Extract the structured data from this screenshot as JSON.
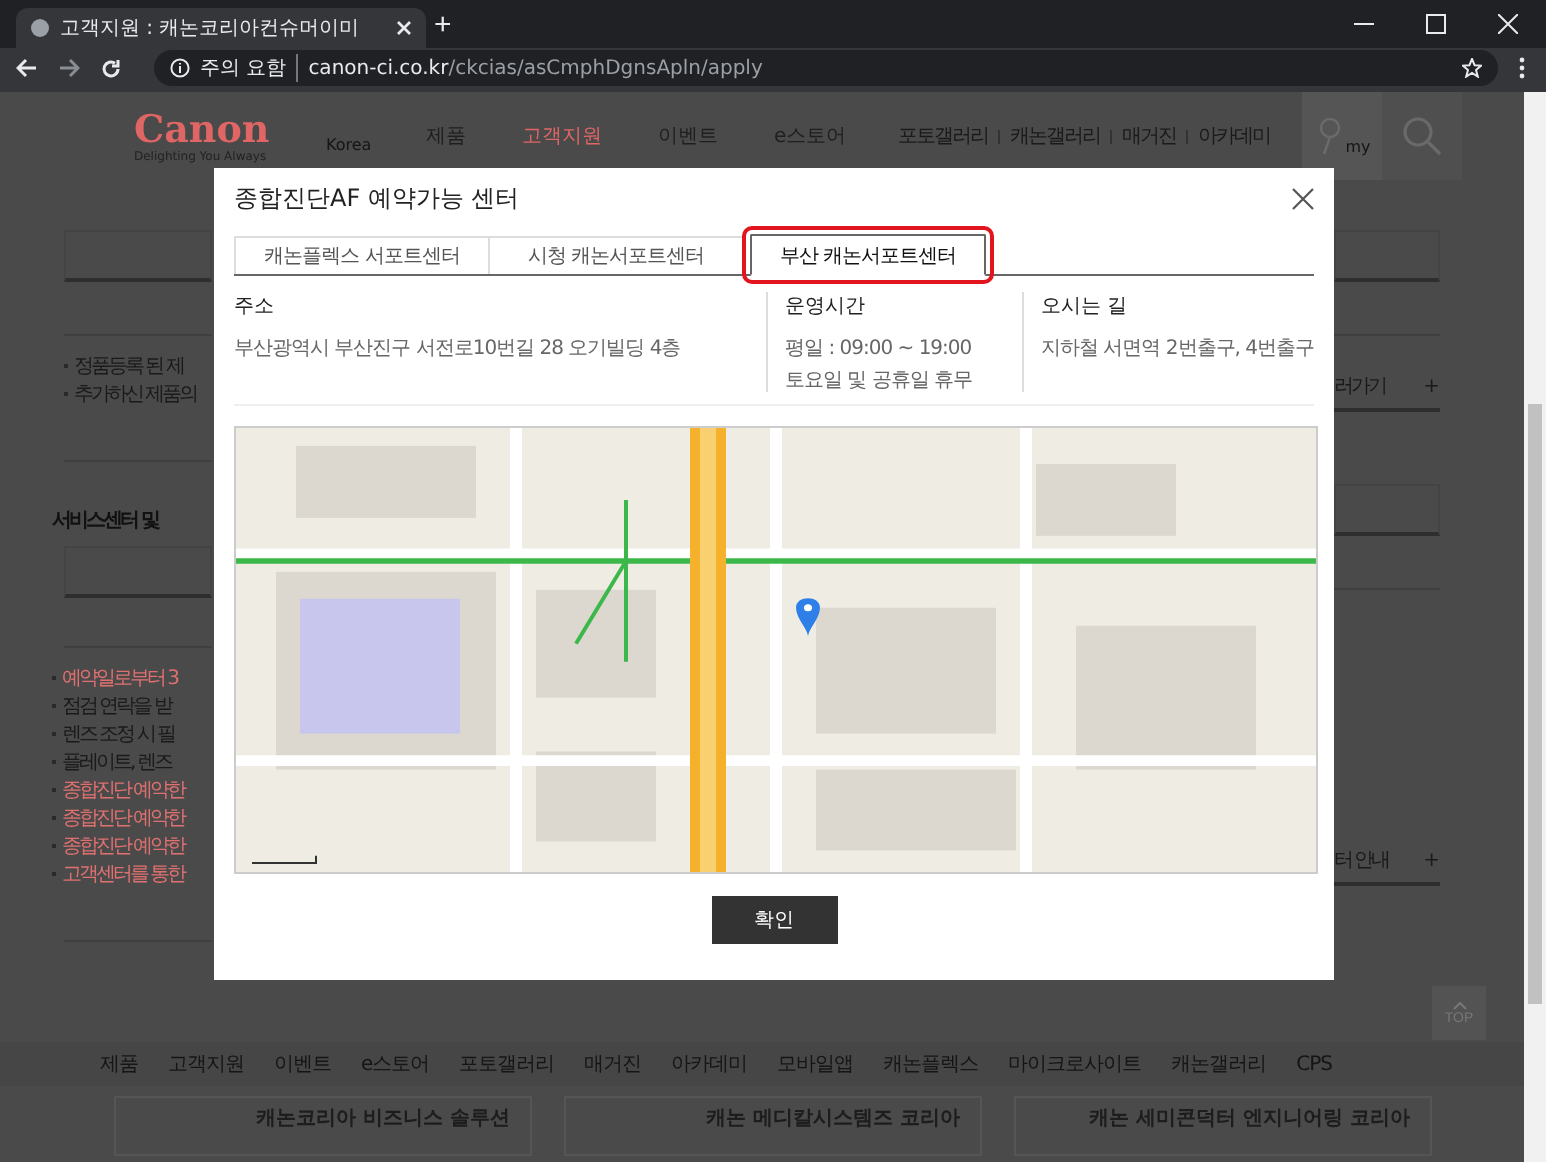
{
  "browser": {
    "tab_title": "고객지원 : 캐논코리아컨슈머이미",
    "new_tab": "+",
    "security": "주의 요함",
    "url_host": "canon-ci.co.kr",
    "url_path": "/ckcias/asCmphDgnsApln/apply"
  },
  "header": {
    "logo": "Canon",
    "tagline": "Delighting You Always",
    "region": "Korea",
    "nav": [
      {
        "label": "제품",
        "selected": false
      },
      {
        "label": "고객지원",
        "selected": true
      },
      {
        "label": "이벤트",
        "selected": false
      },
      {
        "label": "e스토어",
        "selected": false
      }
    ],
    "links": [
      "포토갤러리",
      "캐논갤러리",
      "매거진",
      "아카데미"
    ],
    "my_label": "my"
  },
  "background": {
    "notes": [
      "정품등록 된 제",
      "추가하신 제품의"
    ],
    "heading": "서비스센터 및",
    "bullets": [
      {
        "text": "예약일로부터 3",
        "highlighted": true
      },
      {
        "text": "점검 연락을 받",
        "highlighted": false
      },
      {
        "text": "렌즈 조정 시 필",
        "highlighted": false
      },
      {
        "text": "플레이트, 렌즈",
        "highlighted": false
      },
      {
        "text": "종합진단 예약한",
        "highlighted": true
      },
      {
        "text": "종합진단 예약한",
        "highlighted": true
      },
      {
        "text": "종합진단 예약한",
        "highlighted": true
      },
      {
        "text": "고객센터를 통한",
        "highlighted": true
      }
    ],
    "right_links": [
      {
        "text": "러가기",
        "toggle": "+"
      },
      {
        "text": "터 안내",
        "toggle": "+"
      }
    ]
  },
  "modal": {
    "title": "종합진단AF 예약가능 센터",
    "tabs": [
      {
        "label": "캐논플렉스 서포트센터",
        "selected": false
      },
      {
        "label": "시청 캐논서포트센터",
        "selected": false
      },
      {
        "label": "부산 캐논서포트센터",
        "selected": true
      }
    ],
    "info": [
      {
        "label": "주소",
        "lines": [
          "부산광역시 부산진구 서전로10번길 28 오기빌딩 4층"
        ]
      },
      {
        "label": "운영시간",
        "lines": [
          "평일 : 09:00 ~ 19:00",
          "토요일 및 공휴일 휴무"
        ]
      },
      {
        "label": "오시는 길",
        "lines": [
          "지하철 서면역 2번출구, 4번출구"
        ]
      }
    ],
    "confirm": "확인"
  },
  "top_button": "TOP",
  "footer": {
    "nav": [
      "제품",
      "고객지원",
      "이벤트",
      "e스토어",
      "포토갤러리",
      "매거진",
      "아카데미",
      "모바일앱",
      "캐논플렉스",
      "마이크로사이트",
      "캐논갤러리",
      "CPS"
    ],
    "cards": [
      "캐논코리아 비즈니스 솔루션",
      "캐논 메디칼시스템즈 코리아",
      "캐논 세미콘덕터 엔지니어링 코리아"
    ]
  }
}
